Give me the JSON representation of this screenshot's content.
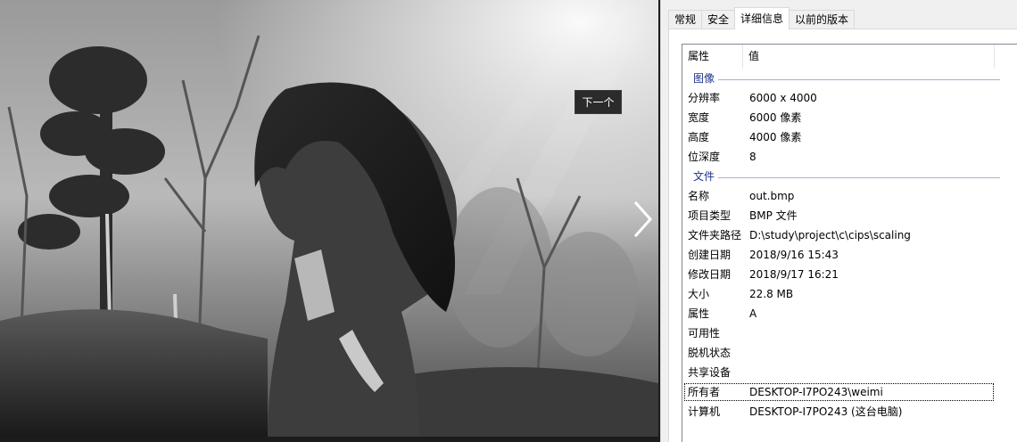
{
  "viewer": {
    "next_tooltip": "下一个"
  },
  "tabs": [
    {
      "label": "常规"
    },
    {
      "label": "安全"
    },
    {
      "label": "详细信息"
    },
    {
      "label": "以前的版本"
    }
  ],
  "active_tab": "详细信息",
  "columns": {
    "property": "属性",
    "value": "值"
  },
  "groups": {
    "image": {
      "label": "图像",
      "rows": [
        {
          "key": "分辨率",
          "value": "6000 x 4000"
        },
        {
          "key": "宽度",
          "value": "6000 像素"
        },
        {
          "key": "高度",
          "value": "4000 像素"
        },
        {
          "key": "位深度",
          "value": "8"
        }
      ]
    },
    "file": {
      "label": "文件",
      "rows": [
        {
          "key": "名称",
          "value": "out.bmp"
        },
        {
          "key": "项目类型",
          "value": "BMP 文件"
        },
        {
          "key": "文件夹路径",
          "value": "D:\\study\\project\\c\\cips\\scaling"
        },
        {
          "key": "创建日期",
          "value": "2018/9/16 15:43"
        },
        {
          "key": "修改日期",
          "value": "2018/9/17 16:21"
        },
        {
          "key": "大小",
          "value": "22.8 MB"
        },
        {
          "key": "属性",
          "value": "A"
        },
        {
          "key": "可用性",
          "value": ""
        },
        {
          "key": "脱机状态",
          "value": ""
        },
        {
          "key": "共享设备",
          "value": ""
        },
        {
          "key": "所有者",
          "value": "DESKTOP-I7PO243\\weimi"
        },
        {
          "key": "计算机",
          "value": "DESKTOP-I7PO243 (这台电脑)"
        }
      ]
    }
  },
  "focused_row": "所有者",
  "colors": {
    "group_label": "#1e3287",
    "group_line": "#a0b4d2",
    "panel_bg": "#f0f0f0"
  }
}
